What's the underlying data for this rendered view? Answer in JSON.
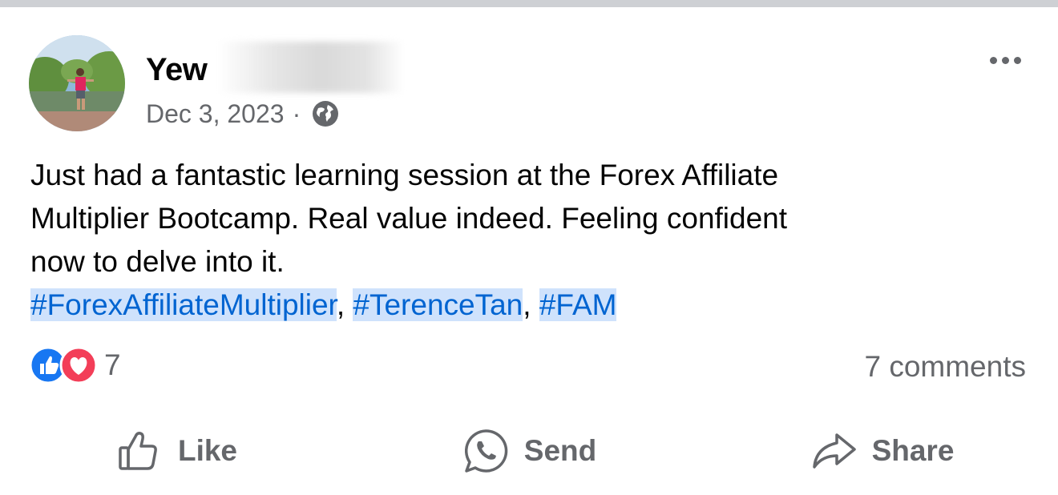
{
  "post": {
    "author_name": "Yew",
    "date": "Dec 3, 2023",
    "separator": "·",
    "privacy_icon": "globe-icon",
    "text_lines": [
      "Just had a fantastic learning session at the Forex Affiliate",
      "Multiplier Bootcamp. Real value indeed. Feeling confident",
      "now to delve into it."
    ],
    "hashtags": [
      "#ForexAffiliateMultiplier",
      "#TerenceTan",
      "#FAM"
    ],
    "hashtag_separator": ", "
  },
  "engagement": {
    "reaction_icons": [
      "like-icon",
      "love-icon"
    ],
    "reaction_count": "7",
    "comments_label": "7 comments"
  },
  "actions": {
    "like_label": "Like",
    "send_label": "Send",
    "share_label": "Share"
  },
  "colors": {
    "hashtag_text": "#0064d1",
    "hashtag_highlight": "#cfe2fc",
    "secondary_text": "#65676b",
    "like_blue": "#1877f2",
    "love_red": "#f33e58"
  }
}
